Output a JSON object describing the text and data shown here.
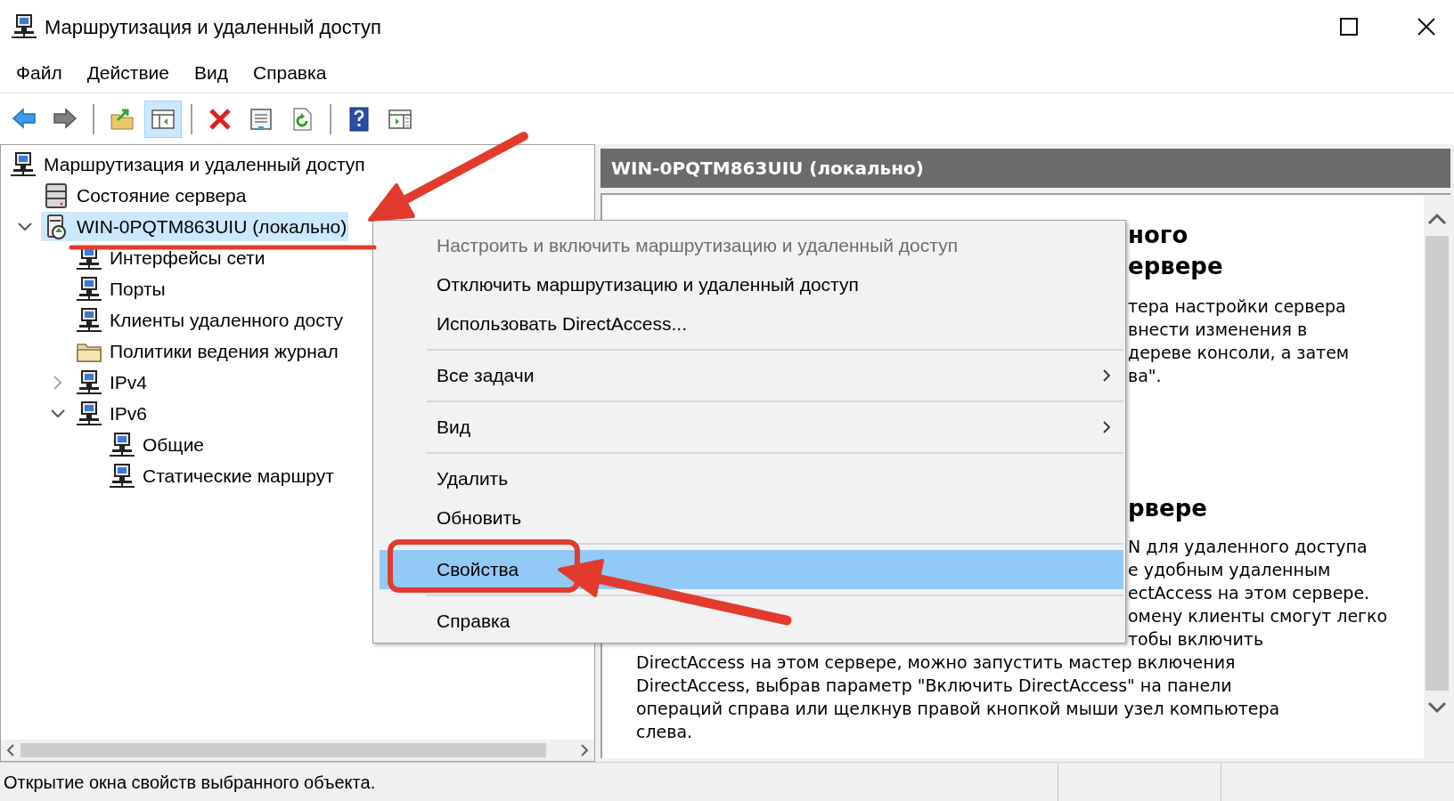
{
  "window": {
    "title": "Маршрутизация и удаленный доступ"
  },
  "menu_bar": [
    "Файл",
    "Действие",
    "Вид",
    "Справка"
  ],
  "toolbar": [
    {
      "pressed": false
    },
    {
      "pressed": false
    },
    {
      "pressed": false
    },
    {
      "pressed": true
    },
    {
      "pressed": false
    },
    {
      "pressed": false
    },
    {
      "pressed": false
    },
    {
      "pressed": false
    },
    {
      "pressed": false
    }
  ],
  "tree": [
    {
      "label": "Маршрутизация и удаленный доступ",
      "kind": "routing",
      "selected": false,
      "children": [
        {
          "label": "Состояние сервера",
          "kind": "status",
          "selected": false
        },
        {
          "label": "WIN-0PQTM863UIU (локально)",
          "kind": "server",
          "selected": true,
          "expanded": true,
          "children": [
            {
              "label": "Интерфейсы сети",
              "kind": "routing",
              "selected": false
            },
            {
              "label": "Порты",
              "kind": "routing",
              "selected": false
            },
            {
              "label": "Клиенты удаленного досту",
              "kind": "routing",
              "selected": false
            },
            {
              "label": "Политики ведения журнал",
              "kind": "folder",
              "selected": false
            },
            {
              "label": "IPv4",
              "kind": "routing",
              "selected": false,
              "expanded": false
            },
            {
              "label": "IPv6",
              "kind": "routing",
              "selected": false,
              "expanded": true,
              "children": [
                {
                  "label": "Общие",
                  "kind": "routing",
                  "selected": false
                },
                {
                  "label": "Статические маршрут",
                  "kind": "routing",
                  "selected": false
                }
              ]
            }
          ]
        }
      ]
    }
  ],
  "details": {
    "header": "WIN-0PQTM863UIU (локально)",
    "heading_1_fragments": [
      "ного",
      "ервере"
    ],
    "paragraph_1_fragments": [
      "тера настройки сервера",
      "внести изменения в",
      "дереве консоли, а затем",
      "ва\"."
    ],
    "heading_2_fragments": [
      "рвере"
    ],
    "paragraph_2_fragments": [
      "N для удаленного доступа",
      "е удобным удаленным",
      "ectAccess на этом сервере.",
      "омену клиенты смогут легко",
      "тобы включить"
    ],
    "paragraph_2_lines": [
      "DirectAccess на этом сервере, можно запустить мастер включения",
      "DirectAccess, выбрав параметр \"Включить DirectAccess\" на панели",
      "операций справа или щелкнув правой кнопкой мыши узел компьютера",
      "слева."
    ]
  },
  "context_menu": [
    {
      "kind": "item",
      "label": "Настроить и включить маршрутизацию и удаленный доступ",
      "disabled": true,
      "submenu": false,
      "selected": false
    },
    {
      "kind": "item",
      "label": "Отключить маршрутизацию и удаленный доступ",
      "disabled": false,
      "submenu": false,
      "selected": false
    },
    {
      "kind": "item",
      "label": "Использовать DirectAccess...",
      "disabled": false,
      "submenu": false,
      "selected": false
    },
    {
      "kind": "separator"
    },
    {
      "kind": "item",
      "label": "Все задачи",
      "disabled": false,
      "submenu": true,
      "selected": false
    },
    {
      "kind": "separator"
    },
    {
      "kind": "item",
      "label": "Вид",
      "disabled": false,
      "submenu": true,
      "selected": false
    },
    {
      "kind": "separator"
    },
    {
      "kind": "item",
      "label": "Удалить",
      "disabled": false,
      "submenu": false,
      "selected": false
    },
    {
      "kind": "item",
      "label": "Обновить",
      "disabled": false,
      "submenu": false,
      "selected": false
    },
    {
      "kind": "separator"
    },
    {
      "kind": "item",
      "label": "Свойства",
      "disabled": false,
      "submenu": false,
      "selected": true
    },
    {
      "kind": "separator"
    },
    {
      "kind": "item",
      "label": "Справка",
      "disabled": false,
      "submenu": false,
      "selected": false
    }
  ],
  "status_bar": {
    "text": "Открытие окна свойств выбранного объекта."
  }
}
